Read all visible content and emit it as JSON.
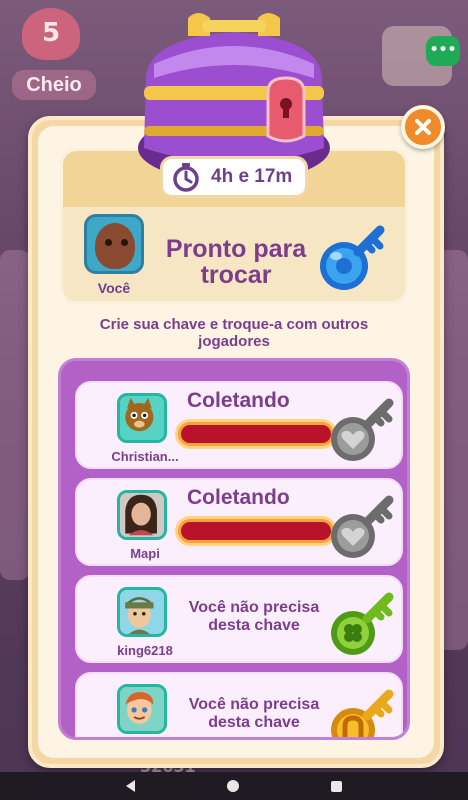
{
  "background": {
    "lives_count": "5",
    "lives_status": "Cheio",
    "bottom_number": "32651",
    "menu_dots": "•••"
  },
  "dialog": {
    "timer": "4h e 17m",
    "you_label": "Você",
    "ready_text": "Pronto para trocar",
    "instructions": "Crie sua chave e troque-a com outros jogadores"
  },
  "players": [
    {
      "name": "Christian...",
      "status": "Coletando",
      "progress": 1.0,
      "key_color": "grey",
      "avatar": "cat"
    },
    {
      "name": "Mapi",
      "status": "Coletando",
      "progress": 1.0,
      "key_color": "grey",
      "avatar": "woman"
    },
    {
      "name": "king6218",
      "status": "Você não precisa desta chave",
      "progress": null,
      "key_color": "green",
      "avatar": "soldier"
    },
    {
      "name": "",
      "status": "Você não precisa desta chave",
      "progress": null,
      "key_color": "gold",
      "avatar": "boy"
    }
  ],
  "colors": {
    "accent_purple": "#7d3d8d",
    "panel_purple": "#b261c6",
    "close_orange": "#f08b2c",
    "bar_red": "#b8132a"
  }
}
